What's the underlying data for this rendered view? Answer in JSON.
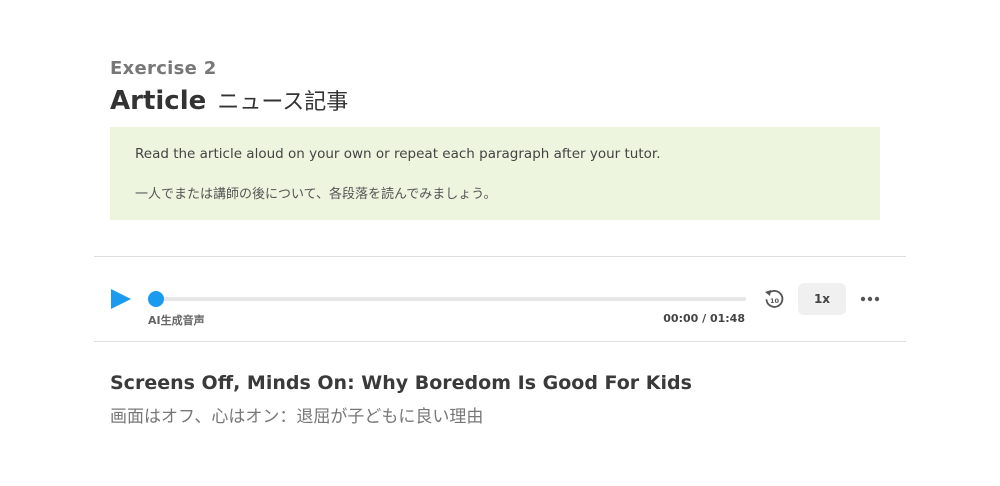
{
  "exercise": {
    "label": "Exercise 2",
    "title_en": "Article",
    "title_ja": "ニュース記事"
  },
  "instructions": {
    "en": "Read the article aloud on your own or repeat each paragraph after your tutor.",
    "ja": "一人でまたは講師の後について、各段落を読んでみましょう。"
  },
  "player": {
    "play_icon": "play-icon",
    "rewind_icon": "rewind-10-icon",
    "rewind_seconds": "10",
    "more_icon": "more-horizontal-icon",
    "ai_label": "AI生成音声",
    "time_readout": "00:00 / 01:48",
    "speed": "1x",
    "progress": 0,
    "accent_color": "#1a9bf0"
  },
  "article": {
    "title_en": "Screens Off, Minds On: Why Boredom Is Good For Kids",
    "title_ja": "画面はオフ、心はオン：退屈が子どもに良い理由"
  },
  "colors": {
    "instruction_background": "#edf5df",
    "divider": "#dddddd"
  }
}
